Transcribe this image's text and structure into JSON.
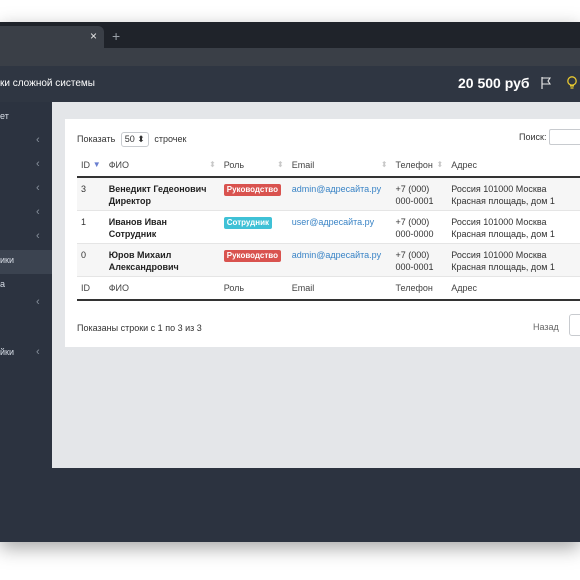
{
  "browser": {
    "tab_close": "×",
    "new_tab": "+"
  },
  "header": {
    "title": "ки сложной системы",
    "balance": "20 500 руб",
    "icons": [
      "flag-icon",
      "lightbulb-icon"
    ],
    "bulb_color": "#e8c930"
  },
  "sidebar": {
    "items": [
      {
        "label": "ет",
        "chevron": ""
      },
      {
        "label": "",
        "chevron": "‹"
      },
      {
        "label": "",
        "chevron": "‹"
      },
      {
        "label": "",
        "chevron": "‹"
      },
      {
        "label": "",
        "chevron": "‹"
      },
      {
        "label": "",
        "chevron": "‹"
      },
      {
        "label": "ики",
        "chevron": "",
        "active": true
      },
      {
        "label": "а",
        "chevron": ""
      },
      {
        "label": "",
        "chevron": "‹"
      },
      {
        "label": "",
        "chevron": ""
      },
      {
        "label": "йки",
        "chevron": "‹"
      }
    ]
  },
  "table_controls": {
    "show_prefix": "Показать",
    "per_page": "50 ⬍",
    "show_suffix": "строчек",
    "search_label": "Поиск:",
    "search_value": ""
  },
  "table": {
    "columns": [
      "ID",
      "ФИО",
      "Роль",
      "Email",
      "Телефон",
      "Адрес"
    ],
    "footer_columns": [
      "ID",
      "ФИО",
      "Роль",
      "Email",
      "Телефон",
      "Адрес"
    ],
    "rows": [
      {
        "id": "3",
        "name_line1": "Венедикт Гедеонович",
        "name_line2": "Директор",
        "role": "Руководство",
        "role_color": "#d9534f",
        "email": "admin@адресайта.ру",
        "phone_line1": "+7 (000)",
        "phone_line2": "000-0001",
        "address_line1": "Россия 101000 Москва",
        "address_line2": "Красная площадь, дом 1"
      },
      {
        "id": "1",
        "name_line1": "Иванов Иван",
        "name_line2": "Сотрудник",
        "role": "Сотрудник",
        "role_color": "#3fc1d6",
        "email": "user@адресайта.ру",
        "phone_line1": "+7 (000)",
        "phone_line2": "000-0000",
        "address_line1": "Россия 101000 Москва",
        "address_line2": "Красная площадь, дом 1"
      },
      {
        "id": "0",
        "name_line1": "Юров Михаил",
        "name_line2": "Александрович",
        "role": "Руководство",
        "role_color": "#d9534f",
        "email": "admin@адресайта.ру",
        "phone_line1": "+7 (000)",
        "phone_line2": "000-0001",
        "address_line1": "Россия 101000 Москва",
        "address_line2": "Красная площадь, дом 1"
      }
    ]
  },
  "pagination": {
    "info": "Показаны строки с 1 по 3 из 3",
    "prev": "Назад"
  }
}
